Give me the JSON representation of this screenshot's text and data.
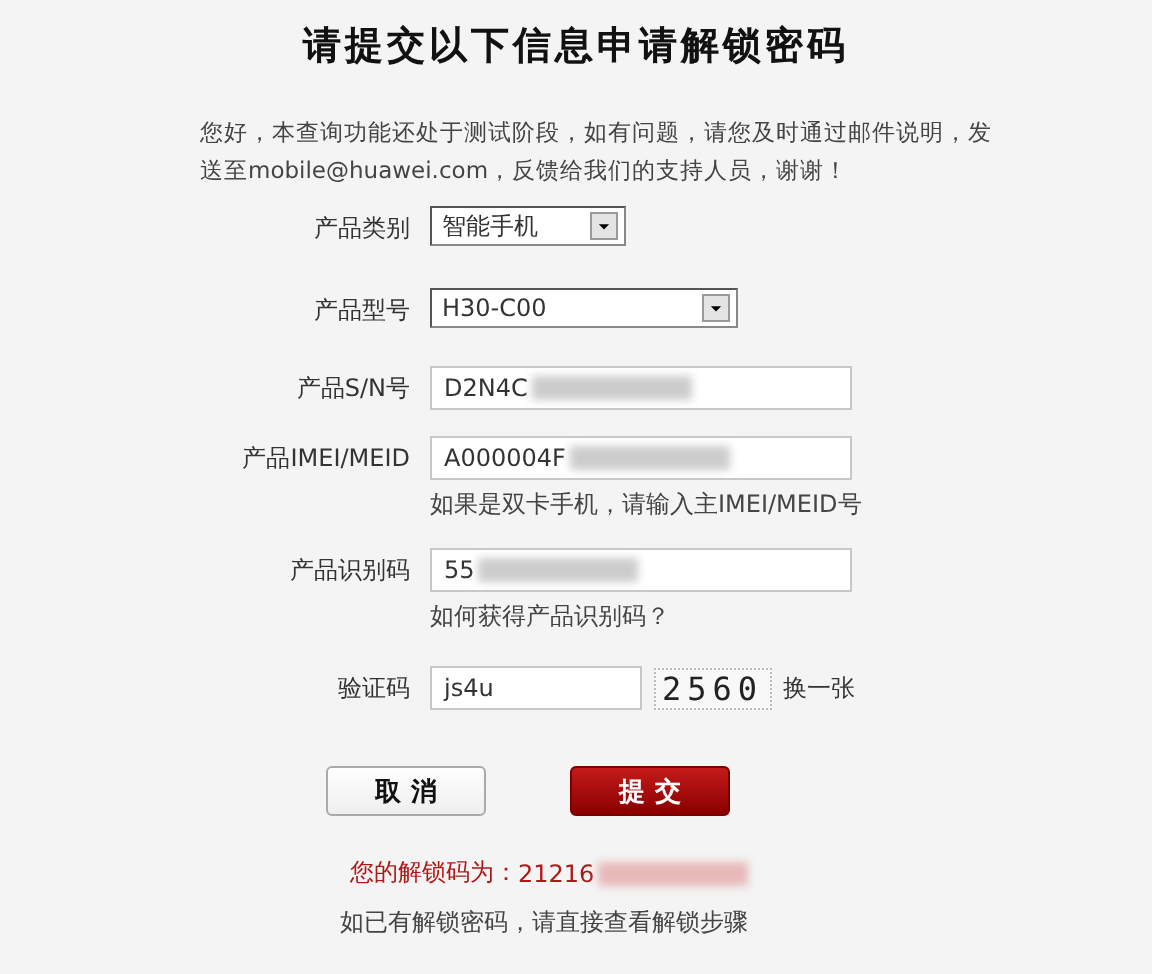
{
  "title": "请提交以下信息申请解锁密码",
  "intro": "您好，本查询功能还处于测试阶段，如有问题，请您及时通过邮件说明，发送至mobile@huawei.com，反馈给我们的支持人员，谢谢！",
  "fields": [
    {
      "kind": "select",
      "label": "产品类别",
      "value": "智能手机",
      "wide": false
    },
    {
      "kind": "select",
      "label": "产品型号",
      "value": "H30-C00",
      "wide": true
    },
    {
      "kind": "text",
      "label": "产品S/N号",
      "value": "D2N4C",
      "redacted": true
    },
    {
      "kind": "text",
      "label": "产品IMEI/MEID",
      "value": "A000004F",
      "redacted": true,
      "hint": "如果是双卡手机，请输入主IMEI/MEID号"
    },
    {
      "kind": "text",
      "label": "产品识别码",
      "value": "55",
      "redacted": true,
      "hint": "如何获得产品识别码？"
    },
    {
      "kind": "captcha",
      "label": "验证码",
      "value": "js4u",
      "captcha": "2560",
      "refresh": "换一张"
    }
  ],
  "buttons": [
    {
      "label": "取 消",
      "kind": "secondary"
    },
    {
      "label": "提 交",
      "kind": "primary"
    }
  ],
  "result": {
    "label": "您的解锁码为：",
    "value": "21216",
    "redacted": true
  },
  "footer": "如已有解锁密码，请直接查看解锁步骤"
}
